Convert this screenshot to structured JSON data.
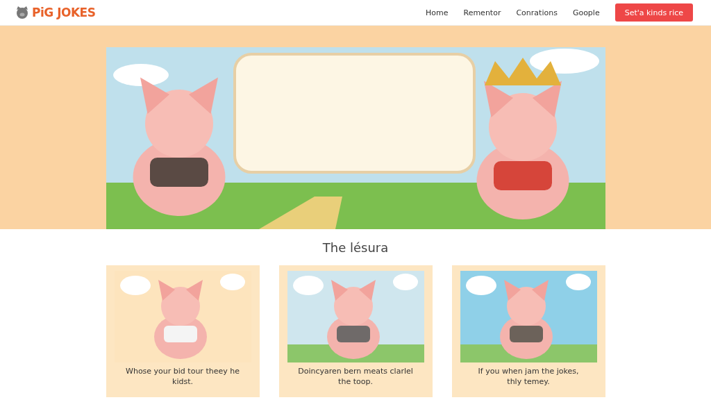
{
  "header": {
    "logo": "PiG JOKES",
    "nav": [
      {
        "label": "Home"
      },
      {
        "label": "Rementor"
      },
      {
        "label": "Conrations"
      },
      {
        "label": "Goople"
      }
    ],
    "cta": "Set'a kinds rice"
  },
  "section": {
    "title": "The lésura",
    "cards": [
      {
        "caption": "Whose your bid tour theey he kidst."
      },
      {
        "caption": "Doincyaren bern meats clarlel the toop."
      },
      {
        "caption": "If you when jam the jokes, thly temey."
      }
    ]
  }
}
